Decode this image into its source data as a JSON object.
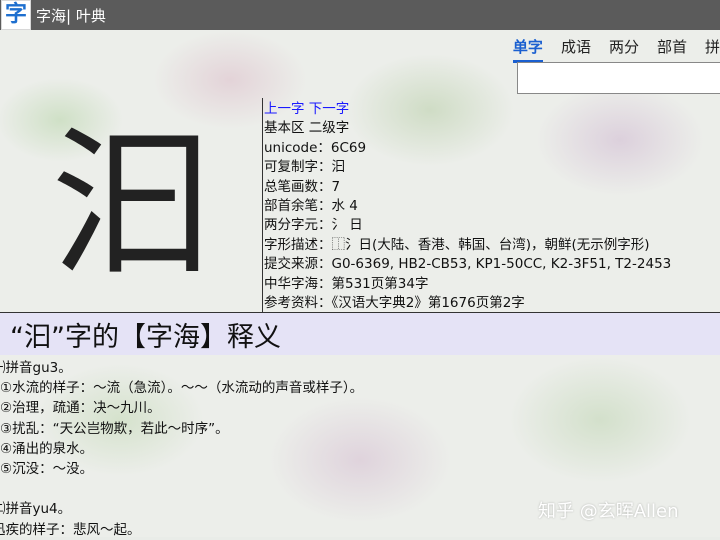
{
  "titlebar": {
    "logo_char": "字",
    "title": "字海| 叶典"
  },
  "tabs": [
    {
      "label": "单字",
      "active": true
    },
    {
      "label": "成语"
    },
    {
      "label": "两分"
    },
    {
      "label": "部首"
    },
    {
      "label": "拼"
    }
  ],
  "search": {
    "value": ""
  },
  "character": {
    "glyph": "汩"
  },
  "info": {
    "prev_link": "上一字",
    "next_link": "下一字",
    "lines": [
      "基本区 二级字",
      "unicode：6C69",
      "可复制字：汩",
      "总笔画数：7",
      "部首余笔：水 4",
      "两分字元：氵 日",
      "字形描述：⿰氵日(大陆、香港、韩国、台湾)，朝鲜(无示例字形)",
      "提交来源：G0-6369, HB2-CB53, KP1-50CC, K2-3F51, T2-2453",
      "中华字海：第531页第34字",
      "参考资料：《汉语大字典2》第1676页第2字"
    ]
  },
  "heading": "“汩”字的【字海】释义",
  "definitions": {
    "group1": [
      "㈠拼音gu3。",
      "①水流的样子：～流（急流）。～～（水流动的声音或样子）。",
      "②治理，疏通：决～九川。",
      "③扰乱：“天公岂物欺，若此～时序”。",
      "④涌出的泉水。",
      "⑤沉没：～没。"
    ],
    "group2": [
      "㈡拼音yu4。",
      "迅疾的样子：悲风～起。"
    ]
  },
  "watermark": "知乎 @玄晖Allen"
}
